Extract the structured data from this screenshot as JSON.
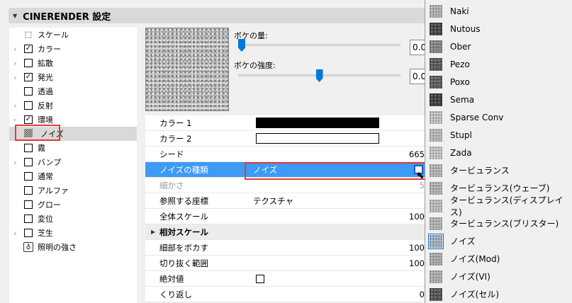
{
  "header": {
    "title": "CINERENDER 設定"
  },
  "tree": [
    {
      "label": "スケール",
      "icon": "scale-icon",
      "check": null,
      "chev": ""
    },
    {
      "label": "カラー",
      "check": true,
      "chev": ">"
    },
    {
      "label": "拡散",
      "check": false,
      "chev": ">"
    },
    {
      "label": "発光",
      "check": true,
      "chev": ">"
    },
    {
      "label": "透過",
      "check": false,
      "chev": ""
    },
    {
      "label": "反射",
      "check": false,
      "chev": ">"
    },
    {
      "label": "環境",
      "check": true,
      "chev": "v"
    },
    {
      "label": "ノイズ",
      "icon": "noise-icon",
      "check": null,
      "chev": "",
      "selected": true
    },
    {
      "label": "霧",
      "check": false,
      "chev": ""
    },
    {
      "label": "バンプ",
      "check": false,
      "chev": ">"
    },
    {
      "label": "通常",
      "check": false,
      "chev": ""
    },
    {
      "label": "アルファ",
      "check": false,
      "chev": ""
    },
    {
      "label": "グロー",
      "check": false,
      "chev": ""
    },
    {
      "label": "変位",
      "check": false,
      "chev": ""
    },
    {
      "label": "芝生",
      "check": false,
      "chev": ">"
    },
    {
      "label": "照明の強さ",
      "icon": "light-intensity-icon",
      "check": null,
      "chev": ""
    }
  ],
  "sliders": [
    {
      "label": "ボケの量:",
      "value": "0.0",
      "fraction": 0.0
    },
    {
      "label": "ボケの強度:",
      "value": "0.0",
      "fraction": 0.5
    }
  ],
  "props": {
    "color1": {
      "label": "カラー 1",
      "color": "#000000"
    },
    "color2": {
      "label": "カラー 2",
      "color": "#ffffff"
    },
    "seed": {
      "label": "シード",
      "value": "665"
    },
    "noise_type": {
      "label": "ノイズの種類",
      "value": "ノイズ"
    },
    "fineness": {
      "label": "細かさ",
      "value": "5"
    },
    "coords": {
      "label": "参照する座標",
      "value": "テクスチャ"
    },
    "global_scale": {
      "label": "全体スケール",
      "value": "100"
    },
    "relative_scale": {
      "label": "相対スケール"
    },
    "blur_detail": {
      "label": "細部をボカす",
      "value": "100"
    },
    "clip_range": {
      "label": "切り抜く範囲",
      "value": "100"
    },
    "absolute": {
      "label": "絶対値",
      "checked": false
    },
    "repeat": {
      "label": "くり返し",
      "value": "0"
    }
  },
  "dropdown": [
    {
      "label": "Naki",
      "tone": "#b8b8b8"
    },
    {
      "label": "Nutous",
      "tone": "#444444"
    },
    {
      "label": "Ober",
      "tone": "#8a8a8a"
    },
    {
      "label": "Pezo",
      "tone": "#5a5a5a"
    },
    {
      "label": "Poxo",
      "tone": "#5e5e5e"
    },
    {
      "label": "Sema",
      "tone": "#3c3c3c"
    },
    {
      "label": "Sparse Conv",
      "tone": "#c8c8c8"
    },
    {
      "label": "Stupl",
      "tone": "#c0c0c0"
    },
    {
      "label": "Zada",
      "tone": "#cccccc"
    },
    {
      "label": "タービュランス",
      "tone": "#bcbcbc"
    },
    {
      "label": "タービュランス(ウェーブ)",
      "tone": "#b8b8b8"
    },
    {
      "label": "タービュランス(ディスプレイス)",
      "tone": "#c4c4c4"
    },
    {
      "label": "タービュランス(ブリスター)",
      "tone": "#bbbbbb"
    },
    {
      "label": "ノイズ",
      "tone": "#a8b8c8",
      "current": true
    },
    {
      "label": "ノイズ(Mod)",
      "tone": "#b0b0b0"
    },
    {
      "label": "ノイズ(VI)",
      "tone": "#b4b4b4"
    },
    {
      "label": "ノイズ(セル)",
      "tone": "#555555"
    }
  ]
}
